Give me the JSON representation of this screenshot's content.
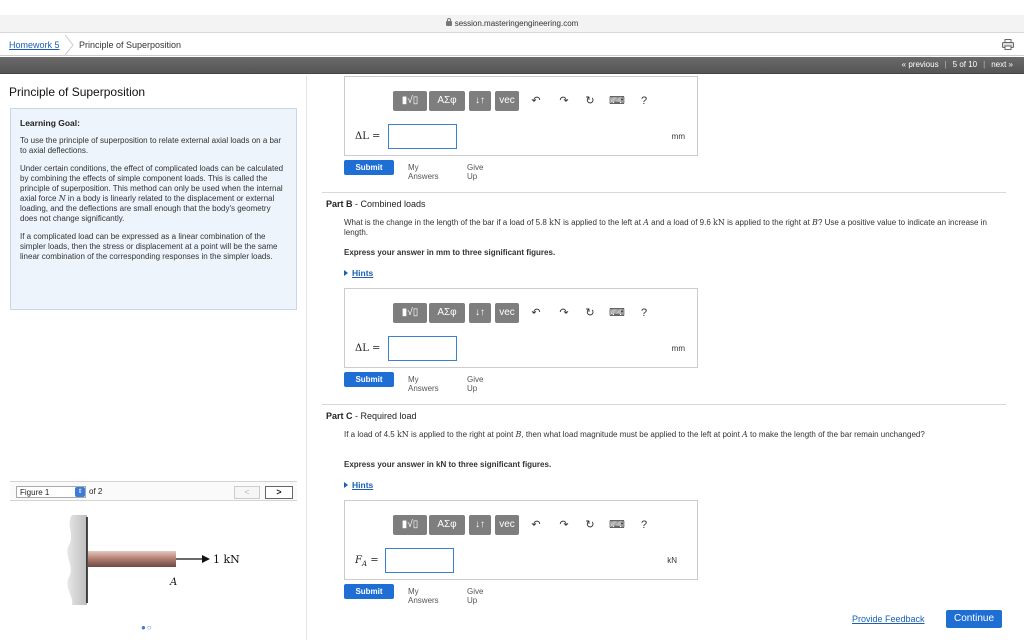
{
  "browser": {
    "url": "session.masteringengineering.com"
  },
  "breadcrumb": {
    "home": "Homework 5",
    "current": "Principle of Superposition"
  },
  "nav": {
    "previous": "« previous",
    "position": "5 of 10",
    "next": "next »"
  },
  "left": {
    "title": "Principle of Superposition",
    "goal_heading": "Learning Goal:",
    "goal_text": "To use the principle of superposition to relate external axial loads on a bar to axial deflections.",
    "para2_a": "Under certain conditions, the effect of complicated loads can be calculated by combining the effects of simple component loads. This is called the principle of superposition. This method can only be used when the internal axial force ",
    "para2_var": "N",
    "para2_b": " in a body is linearly related to the displacement or external loading, and the deflections are small enough that the body's geometry does not change significantly.",
    "para3": "If a complicated load can be expressed as a linear combination of the simpler loads, then the stress or displacement at a point will be the same linear combination of the corresponding responses in the simpler loads."
  },
  "figure": {
    "selected": "Figure 1",
    "of": "of 2",
    "prev": "<",
    "next": ">",
    "load_label": "1 kN",
    "point_label": "A"
  },
  "toolbar": {
    "templates": "▮√▯",
    "greek": "ΑΣφ",
    "arrows": "↓↑",
    "vec": "vec",
    "undo": "↶",
    "redo": "↷",
    "reset": "↻",
    "keyboard": "⌨",
    "help": "?"
  },
  "part_a": {
    "var": "ΔL =",
    "unit": "mm",
    "submit": "Submit",
    "my_answers": "My Answers",
    "give_up": "Give Up"
  },
  "part_b": {
    "label": "Part B",
    "title": " - Combined loads",
    "q1": "What is the change in the length of the bar if a load of 5.8 ",
    "u1": "kN",
    "q2": " is applied to the left at ",
    "p1": "A",
    "q3": " and a load of 9.6 ",
    "u2": "kN",
    "q4": " is applied to the right at ",
    "p2": "B",
    "q5": "? Use a positive value to indicate an increase in length.",
    "express": "Express your answer in mm to three significant figures.",
    "hints": "Hints",
    "var": "ΔL =",
    "unit": "mm",
    "submit": "Submit",
    "my_answers": "My Answers",
    "give_up": "Give Up"
  },
  "part_c": {
    "label": "Part C",
    "title": " - Required load",
    "q1": "If a load of 4.5 ",
    "u1": "kN",
    "q2": " is applied to the right at point ",
    "p1": "B",
    "q3": ", then what load magnitude must be applied to the left at point ",
    "p2": "A",
    "q4": " to make the length of the bar remain unchanged?",
    "express": "Express your answer in kN to three significant figures.",
    "hints": "Hints",
    "var": "F",
    "var_sub": "A",
    "var_eq": " =",
    "unit": "kN",
    "submit": "Submit",
    "my_answers": "My Answers",
    "give_up": "Give Up"
  },
  "footer": {
    "feedback": "Provide Feedback",
    "continue": "Continue"
  }
}
